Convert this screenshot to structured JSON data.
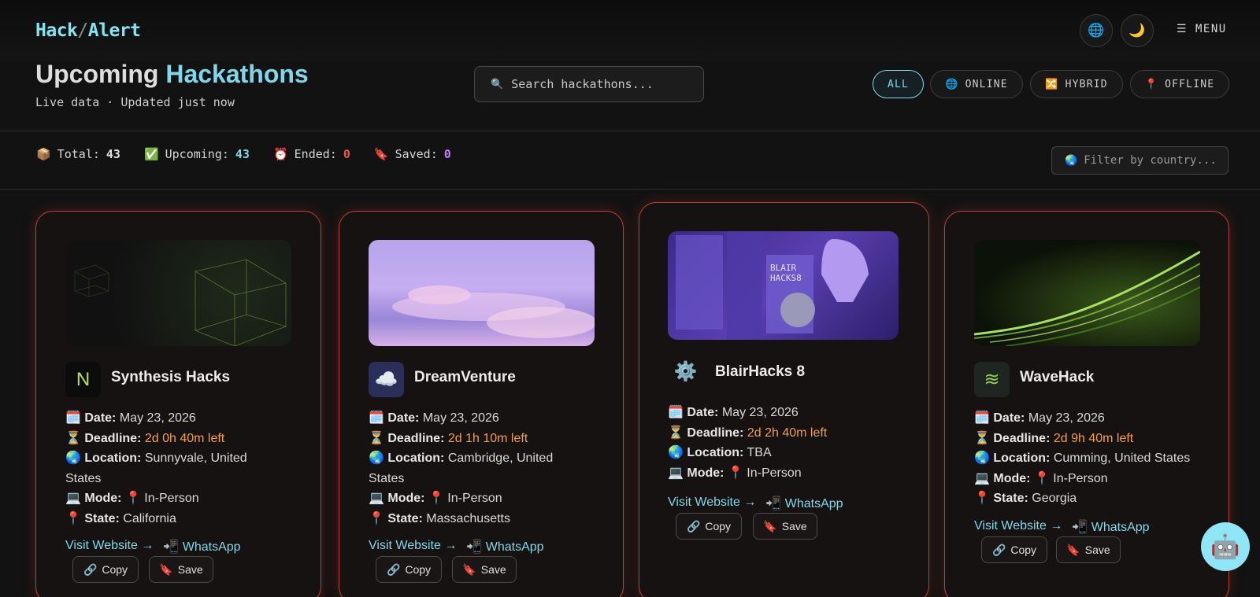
{
  "header": {
    "logo_left": "Hack",
    "logo_sep": "/",
    "logo_right": "Alert",
    "globe_icon": "🌐",
    "theme_icon": "🌙",
    "menu_label": "☰ MENU"
  },
  "hero": {
    "title_plain": "Upcoming",
    "title_accent": "Hackathons",
    "subtitle": "Live data · Updated just now"
  },
  "search": {
    "icon": "🔍",
    "placeholder": "Search hackathons..."
  },
  "filters": [
    {
      "icon": "",
      "label": "ALL"
    },
    {
      "icon": "🌐",
      "label": "ONLINE"
    },
    {
      "icon": "🔀",
      "label": "HYBRID"
    },
    {
      "icon": "📍",
      "label": "OFFLINE"
    }
  ],
  "stats": [
    {
      "icon": "📦",
      "label": "Total:",
      "value": "43",
      "color": "#e0e0e0"
    },
    {
      "icon": "✅",
      "label": "Upcoming:",
      "value": "43",
      "color": "#7fd8ea"
    },
    {
      "icon": "⏰",
      "label": "Ended:",
      "value": "0",
      "color": "#e85a4f"
    },
    {
      "icon": "🔖",
      "label": "Saved:",
      "value": "0",
      "color": "#c77dff"
    }
  ],
  "country_filter": {
    "icon": "🌏",
    "placeholder": "Filter by country..."
  },
  "labels": {
    "date": "Date:",
    "deadline": "Deadline:",
    "location": "Location:",
    "mode": "Mode:",
    "state": "State:",
    "visit": "Visit Website →",
    "whatsapp": "WhatsApp",
    "copy": "Copy",
    "save": "Save"
  },
  "cards": [
    {
      "name": "Synthesis Hacks",
      "logo_icon": "hexagon-n-logo",
      "date": "May 23, 2026",
      "deadline": "2d 0h 40m left",
      "location_l1": "Sunnyvale, United",
      "location_l2": "States",
      "mode": "📍 In-Person",
      "state": "California"
    },
    {
      "name": "DreamVenture",
      "logo_icon": "cloud-logo",
      "date": "May 23, 2026",
      "deadline": "2d 1h 10m left",
      "location_l1": "Cambridge, United",
      "location_l2": "States",
      "mode": "📍 In-Person",
      "state": "Massachusetts"
    },
    {
      "name": "BlairHacks 8",
      "logo_icon": "gear-rocket-logo",
      "date": "May 23, 2026",
      "deadline": "2d 2h 40m left",
      "location_l1": "TBA",
      "location_l2": "",
      "mode": "📍 In-Person",
      "state": ""
    },
    {
      "name": "WaveHack",
      "logo_icon": "wave-logo",
      "date": "May 23, 2026",
      "deadline": "2d 9h 40m left",
      "location_l1": "Cumming, United States",
      "location_l2": "",
      "mode": "📍 In-Person",
      "state": "Georgia"
    }
  ],
  "assistant_icon": "🤖",
  "colors": {
    "accent": "#7fd8ea",
    "card_border": "#c2402f",
    "deadline": "#f0a040"
  }
}
